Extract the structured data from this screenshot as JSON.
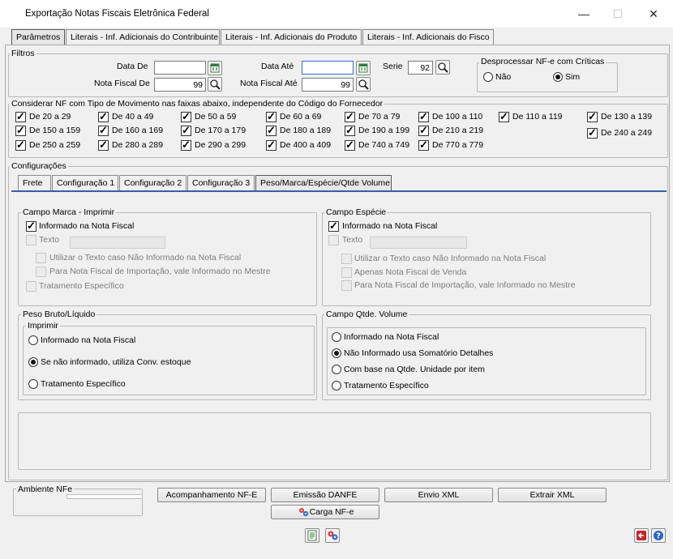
{
  "window": {
    "title": "Exportação Notas Fiscais Eletrônica Federal",
    "minimize": "—",
    "maximize": "☐",
    "close": "✕"
  },
  "main_tabs": [
    {
      "label": "Parâmetros",
      "active": true
    },
    {
      "label": "Literais - Inf. Adicionais do Contribuinte"
    },
    {
      "label": "Literais - Inf. Adicionais do Produto"
    },
    {
      "label": "Literais - Inf. Adicionais do Fisco"
    }
  ],
  "filtros": {
    "legend": "Filtros",
    "data_de_label": "Data De",
    "data_de_value": "",
    "data_ate_label": "Data Até",
    "data_ate_value": "",
    "serie_label": "Serie",
    "serie_value": "92",
    "nf_de_label": "Nota Fiscal De",
    "nf_de_value": "99",
    "nf_ate_label": "Nota Fiscal Até",
    "nf_ate_value": "99",
    "desprocessar": {
      "legend": "Desprocessar NF-e com Críticas",
      "nao": "Não",
      "sim": "Sim",
      "selected": "Sim"
    }
  },
  "faixas": {
    "legend": "Considerar NF com Tipo de Movimento nas faixas abaixo, independente do Código do Fornecedor",
    "items": [
      "De 20 a 29",
      "De 40 a 49",
      "De 50 a 59",
      "De 60 a 69",
      "De 70 a 79",
      "De 100 a 110",
      "De 110 a 119",
      "De 130 a 139",
      "De 150 a 159",
      "De 160 a 169",
      "De 170 a 179",
      "De 180 a 189",
      "De 190 a 199",
      "De 210 a 219",
      "De 240 a 249",
      "De 250 a 259",
      "De 280 a 289",
      "De 290 a 299",
      "De 400 a 409",
      "De 740 a 749",
      "De 770 a 779"
    ]
  },
  "configuracoes": {
    "legend": "Configurações",
    "tabs": [
      "Frete",
      "Configuração 1",
      "Configuração 2",
      "Configuração 3",
      "Peso/Marca/Espécie/Qtde Volume"
    ],
    "active_tab": "Peso/Marca/Espécie/Qtde Volume",
    "marca": {
      "legend": "Campo Marca - Imprimir",
      "informado": "Informado na Nota Fiscal",
      "texto": "Texto",
      "texto_value": "",
      "utilizar": "Utilizar o Texto caso Não Informado na Nota Fiscal",
      "importacao": "Para Nota Fiscal de Importação,  vale Informado no Mestre",
      "especifico": "Tratamento Específico"
    },
    "especie": {
      "legend": "Campo Espécie",
      "informado": "Informado na Nota Fiscal",
      "texto": "Texto",
      "texto_value": "",
      "utilizar": "Utilizar o Texto caso Não Informado na Nota Fiscal",
      "venda": "Apenas Nota Fiscal de Venda",
      "importacao": "Para Nota Fiscal de Importação,  vale Informado no Mestre"
    },
    "peso": {
      "legend": "Peso Bruto/Líquido",
      "imprimir": "Imprimir",
      "opt1": "Informado na Nota Fiscal",
      "opt2": "Se não informado, utiliza Conv. estoque",
      "opt3": "Tratamento Específico",
      "selected": 2
    },
    "volume": {
      "legend": "Campo Qtde. Volume",
      "opt1": "Informado na Nota Fiscal",
      "opt2": "Não Informado usa Somatório Detalhes",
      "opt3": "Com base na Qtde. Unidade por item",
      "opt4": "Tratamento Específico",
      "selected": 2
    }
  },
  "ambiente": {
    "legend": "Ambiente NFe",
    "acompanhamento": "Acompanhamento NF-E",
    "emissao": "Emissão DANFE",
    "envio": "Envio XML",
    "extrair": "Extrair XML",
    "carga": "Carga NF-e"
  },
  "colors": {
    "accent": "#2a63c6",
    "exit": "#c0262a"
  }
}
